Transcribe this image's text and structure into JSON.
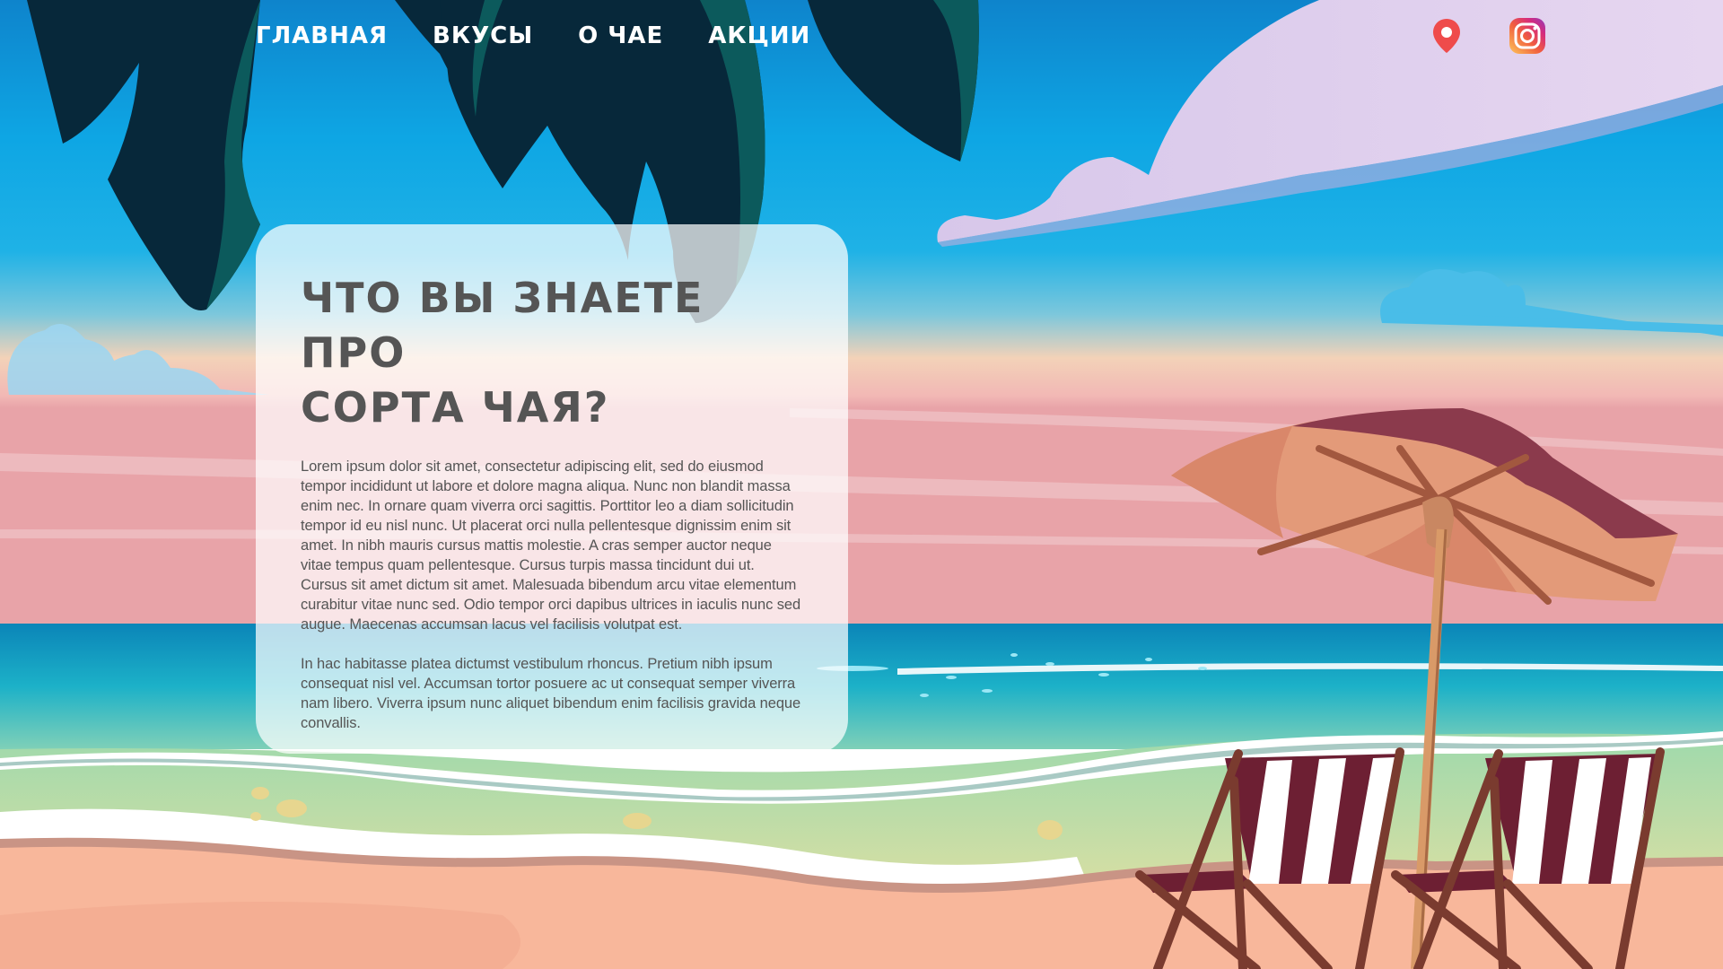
{
  "nav": {
    "items": [
      {
        "label": "ГЛАВНАЯ"
      },
      {
        "label": "ВКУСЫ"
      },
      {
        "label": "О ЧАЕ"
      },
      {
        "label": "АКЦИИ"
      }
    ]
  },
  "header_icons": {
    "location": {
      "icon": "map-pin-icon",
      "color": "#ef4b4b"
    },
    "instagram": {
      "icon": "instagram-icon",
      "color": "#e1306c"
    }
  },
  "card": {
    "title_line1": "ЧТО ВЫ ЗНАЕТЕ ПРО",
    "title_line2": "СОРТА ЧАЯ?",
    "paragraph1": "Lorem ipsum dolor sit amet, consectetur adipiscing elit, sed do eiusmod tempor incididunt ut labore et dolore magna aliqua. Nunc non blandit massa enim nec. In ornare quam viverra orci sagittis. Porttitor leo a diam sollicitudin tempor id eu nisl nunc. Ut placerat orci nulla pellentesque dignissim enim sit amet. In nibh mauris cursus mattis molestie. A cras semper auctor neque vitae tempus quam pellentesque. Cursus turpis massa tincidunt dui ut. Cursus sit amet dictum sit amet. Malesuada bibendum arcu vitae elementum curabitur vitae nunc sed. Odio tempor orci dapibus ultrices in iaculis nunc sed augue. Maecenas accumsan lacus vel facilisis volutpat est.",
    "paragraph2": "In hac habitasse platea dictumst vestibulum rhoncus. Pretium nibh ipsum consequat nisl vel. Accumsan tortor posuere ac ut consequat semper viverra nam libero. Viverra ipsum nunc aliquet bibendum enim facilisis gravida neque convallis."
  },
  "colors": {
    "sky_top": "#0e8fd4",
    "sky_mid": "#11aee8",
    "sunset": "#f7c6b0",
    "sea": "#1aa3c9",
    "sand": "#f8b79b",
    "palm": "#07283a",
    "umbrella": "#e39a79",
    "umbrella_dark": "#8b3a4c",
    "chair_stripe": "#6d1f33",
    "text": "#555555"
  }
}
